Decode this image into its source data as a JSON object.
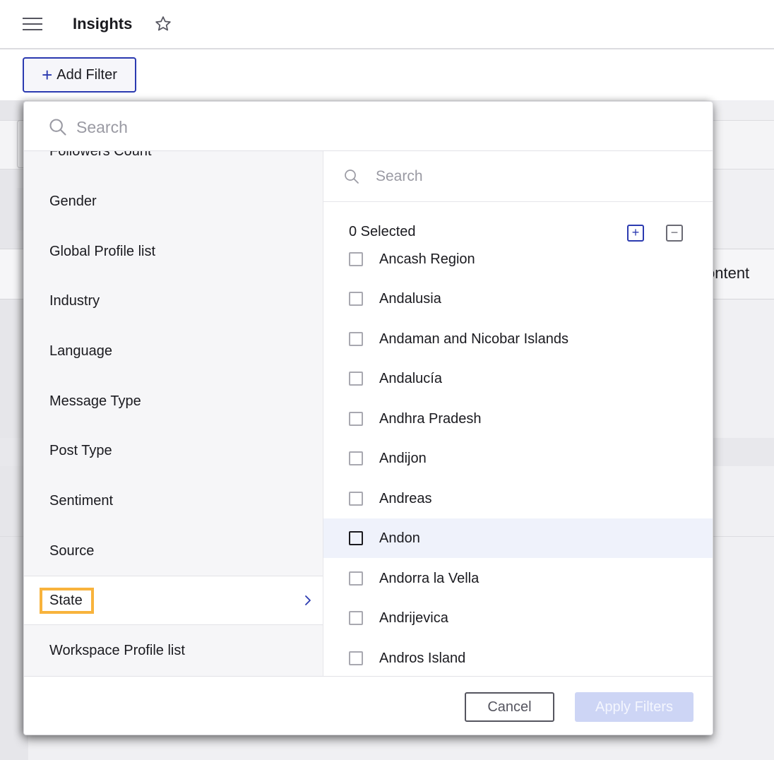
{
  "header": {
    "title": "Insights",
    "menu_icon": "hamburger-menu-icon",
    "favorite_icon": "star-outline-icon"
  },
  "toolbar": {
    "add_filter_label": "Add Filter",
    "add_filter_icon": "plus-icon"
  },
  "background": {
    "partial_label": "ontent"
  },
  "filter_panel": {
    "search_placeholder": "Search",
    "categories": [
      {
        "label": "Followers Count",
        "active": false
      },
      {
        "label": "Gender",
        "active": false
      },
      {
        "label": "Global Profile list",
        "active": false
      },
      {
        "label": "Industry",
        "active": false
      },
      {
        "label": "Language",
        "active": false
      },
      {
        "label": "Message Type",
        "active": false
      },
      {
        "label": "Post Type",
        "active": false
      },
      {
        "label": "Sentiment",
        "active": false
      },
      {
        "label": "Source",
        "active": false
      },
      {
        "label": "State",
        "active": true
      },
      {
        "label": "Workspace Profile list",
        "active": false
      }
    ],
    "options_pane": {
      "search_placeholder": "Search",
      "selected_count_label": "0 Selected",
      "select_all_icon": "plus-square-icon",
      "deselect_all_icon": "minus-square-icon",
      "options": [
        {
          "label": "Ancash Region",
          "checked": false
        },
        {
          "label": "Andalusia",
          "checked": false
        },
        {
          "label": "Andaman and Nicobar Islands",
          "checked": false
        },
        {
          "label": "Andalucía",
          "checked": false
        },
        {
          "label": "Andhra Pradesh",
          "checked": false
        },
        {
          "label": "Andijon",
          "checked": false
        },
        {
          "label": "Andreas",
          "checked": false
        },
        {
          "label": "Andon",
          "checked": false,
          "hovered": true
        },
        {
          "label": "Andorra la Vella",
          "checked": false
        },
        {
          "label": "Andrijevica",
          "checked": false
        },
        {
          "label": "Andros Island",
          "checked": false
        }
      ]
    },
    "footer": {
      "cancel_label": "Cancel",
      "apply_label": "Apply Filters",
      "apply_disabled": true
    }
  },
  "colors": {
    "accent": "#2b3ab0",
    "highlight_outline": "#f8b33c",
    "hover_row": "#eff2fb",
    "apply_disabled_bg": "#cdd5f5"
  }
}
